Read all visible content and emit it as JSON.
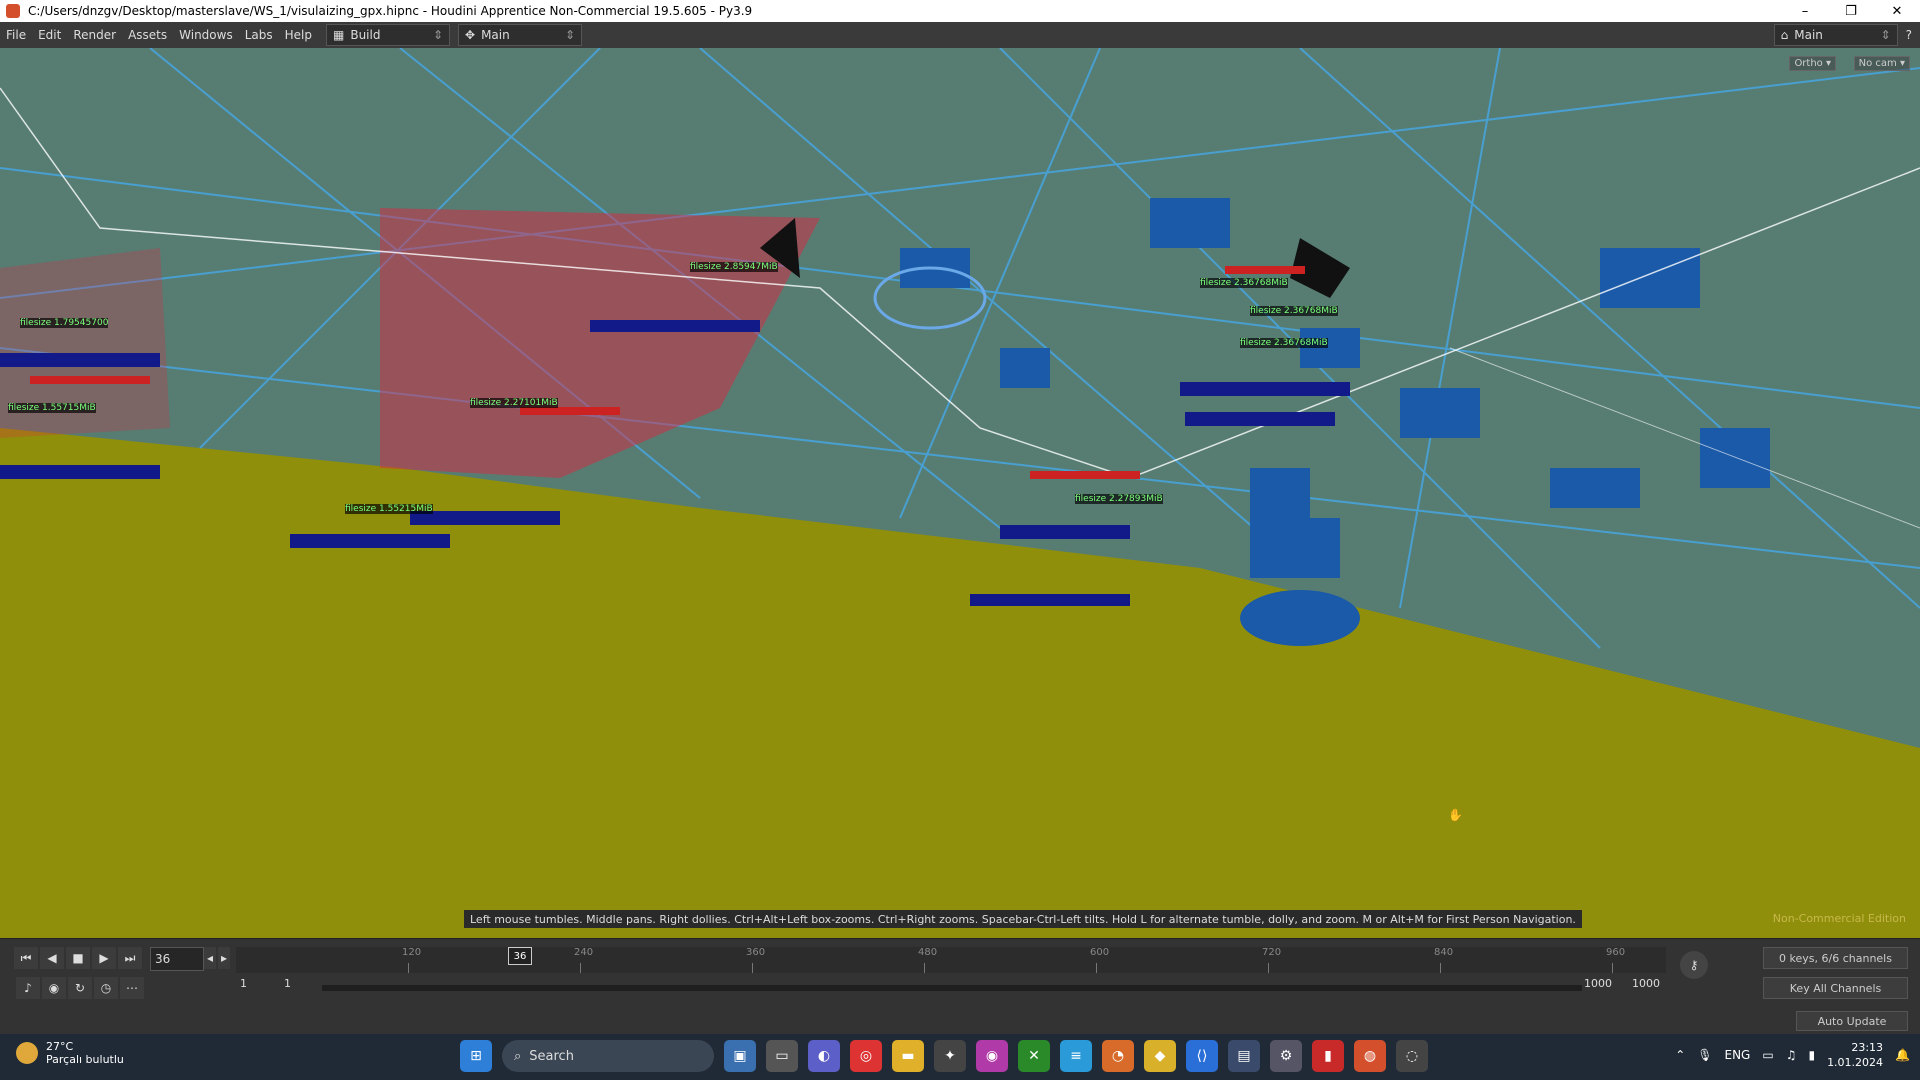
{
  "window": {
    "title": "C:/Users/dnzgv/Desktop/masterslave/WS_1/visulaizing_gpx.hipnc - Houdini Apprentice Non-Commercial 19.5.605 - Py3.9",
    "controls": [
      "–",
      "❐",
      "✕"
    ]
  },
  "menu": {
    "items": [
      "File",
      "Edit",
      "Render",
      "Assets",
      "Windows",
      "Labs",
      "Help"
    ],
    "desktop_build": "Build",
    "desktop_main": "Main",
    "right_main": "Main"
  },
  "viewport": {
    "ortho_label": "Ortho ▾",
    "cam_label": "No cam ▾",
    "hint": "Left mouse tumbles. Middle pans. Right dollies. Ctrl+Alt+Left box-zooms. Ctrl+Right zooms. Spacebar-Ctrl-Left tilts. Hold L for alternate tumble, dolly, and zoom.   M or Alt+M for First Person Navigation.",
    "edition": "Non-Commercial Edition",
    "labels": [
      "filesize 2.36768MiB",
      "filesize 2.36768MiB",
      "filesize 2.36768MiB",
      "filesize 2.27893MiB",
      "filesize 1.55215MiB",
      "filesize 2.27101MiB",
      "filesize 2.85947MiB",
      "filesize 1.55715MiB",
      "filesize 1.79545700"
    ],
    "colors": {
      "ground": "#8f8f0c",
      "buildings": "#2a6fc8",
      "streets": "#45a8e8",
      "highlight": "#e8203a"
    }
  },
  "timeline": {
    "current_frame": "36",
    "marker": "36",
    "ticks": [
      "120",
      "240",
      "360",
      "480",
      "600",
      "720",
      "840",
      "960"
    ],
    "range_start_a": "1",
    "range_start_b": "1",
    "range_end_a": "1000",
    "range_end_b": "1000",
    "keys_info": "0 keys, 6/6 channels",
    "key_all": "Key All Channels",
    "auto_update": "Auto Update"
  },
  "taskbar": {
    "temp": "27°C",
    "weather": "Parçalı bulutlu",
    "search": "Search",
    "lang": "ENG",
    "time": "23:13",
    "date": "1.01.2024"
  }
}
